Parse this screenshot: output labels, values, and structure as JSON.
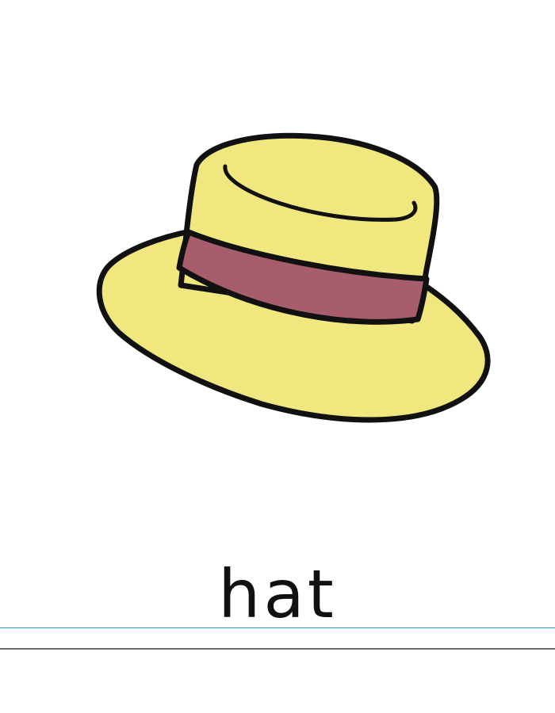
{
  "word": "hat",
  "illustration": {
    "subject": "hat-icon",
    "colors": {
      "straw": "#F0E87E",
      "band": "#A85D6C",
      "outline": "#111111"
    }
  },
  "writing_lines": {
    "colors": {
      "top_bottom": "#6B6B6B",
      "midline": "#A8A8A8",
      "baseline": "#2A9BD8"
    }
  }
}
